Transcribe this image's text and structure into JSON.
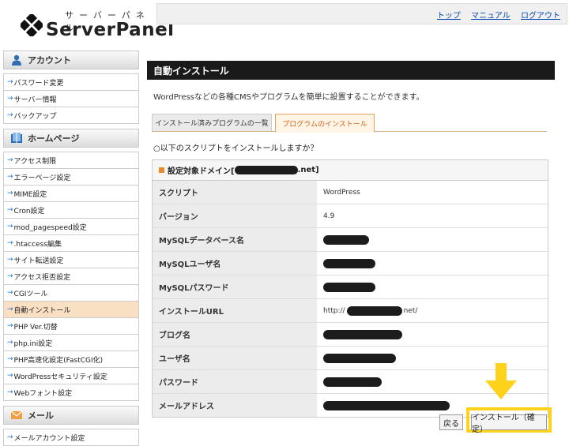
{
  "header": {
    "logo_kana": "サーバーパネル",
    "logo_name": "ServerPanel",
    "links": [
      "トップ",
      "マニュアル",
      "ログアウト"
    ]
  },
  "sidebar": {
    "sections": [
      {
        "title": "アカウント",
        "icon": "person-icon",
        "items": [
          "パスワード変更",
          "サーバー情報",
          "バックアップ"
        ]
      },
      {
        "title": "ホームページ",
        "icon": "book-icon",
        "items": [
          "アクセス制限",
          "エラーページ設定",
          "MIME設定",
          "Cron設定",
          "mod_pagespeed設定",
          ".htaccess編集",
          "サイト転送設定",
          "アクセス拒否設定",
          "CGIツール",
          "自動インストール",
          "PHP Ver.切替",
          "php.ini設定",
          "PHP高速化設定(FastCGI化)",
          "WordPressセキュリティ設定",
          "Webフォント設定"
        ]
      },
      {
        "title": "メール",
        "icon": "mail-icon",
        "items": [
          "メールアカウント設定"
        ]
      }
    ],
    "active_item": "自動インストール"
  },
  "main": {
    "title": "自動インストール",
    "description": "WordPressなどの各種CMSやプログラムを簡単に設置することができます。",
    "tabs": [
      "インストール済みプログラムの一覧",
      "プログラムのインストール"
    ],
    "active_tab": "プログラムのインストール",
    "question": "○以下のスクリプトをインストールしますか？",
    "domain_prefix": "設定対象ドメイン[",
    "domain_suffix": ".net]",
    "rows": [
      {
        "label": "スクリプト",
        "value": "WordPress"
      },
      {
        "label": "バージョン",
        "value": "4.9"
      },
      {
        "label": "MySQLデータベース名",
        "value": ""
      },
      {
        "label": "MySQLユーザ名",
        "value": ""
      },
      {
        "label": "MySQLパスワード",
        "value": ""
      },
      {
        "label": "インストールURL",
        "value": "http://",
        "suffix": "net/"
      },
      {
        "label": "ブログ名",
        "value": ""
      },
      {
        "label": "ユーザ名",
        "value": ""
      },
      {
        "label": "パスワード",
        "value": ""
      },
      {
        "label": "メールアドレス",
        "value": ""
      }
    ],
    "back_button": "戻る",
    "install_button": "インストール（確定）"
  },
  "colors": {
    "title_bar": "#1a1a1a",
    "active_tab": "#d0651b",
    "active_sidebar": "#fae0c3",
    "highlight": "#ffd21c"
  }
}
